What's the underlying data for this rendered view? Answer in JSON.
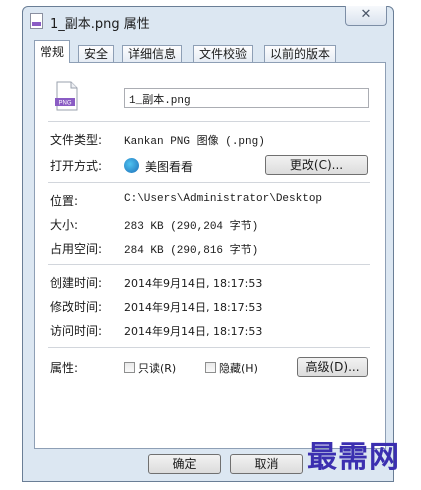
{
  "window": {
    "title": "1_副本.png 属性",
    "close_glyph": "✕"
  },
  "tabs": [
    "常规",
    "安全",
    "详细信息",
    "文件校验",
    "以前的版本"
  ],
  "file": {
    "icon_label": "PNG",
    "name": "1_副本.png"
  },
  "fields": {
    "type_label": "文件类型:",
    "type_value": "Kankan PNG 图像 (.png)",
    "open_label": "打开方式:",
    "open_app": "美图看看",
    "change_button": "更改(C)...",
    "location_label": "位置:",
    "location_value": "C:\\Users\\Administrator\\Desktop",
    "size_label": "大小:",
    "size_value": "283 KB (290,204 字节)",
    "disk_label": "占用空间:",
    "disk_value": "284 KB (290,816 字节)",
    "created_label": "创建时间:",
    "created_value": "2014年9月14日, 18:17:53",
    "modified_label": "修改时间:",
    "modified_value": "2014年9月14日, 18:17:53",
    "accessed_label": "访问时间:",
    "accessed_value": "2014年9月14日, 18:17:53",
    "attr_label": "属性:",
    "readonly_label": "只读(R)",
    "hidden_label": "隐藏(H)",
    "advanced_button": "高级(D)..."
  },
  "footer": {
    "ok": "确定",
    "cancel": "取消"
  },
  "watermark": "最需网",
  "colors": {
    "window_frame": "#dce7f2",
    "watermark": "#3b2fb0",
    "png_badge": "#8a5cc4"
  }
}
